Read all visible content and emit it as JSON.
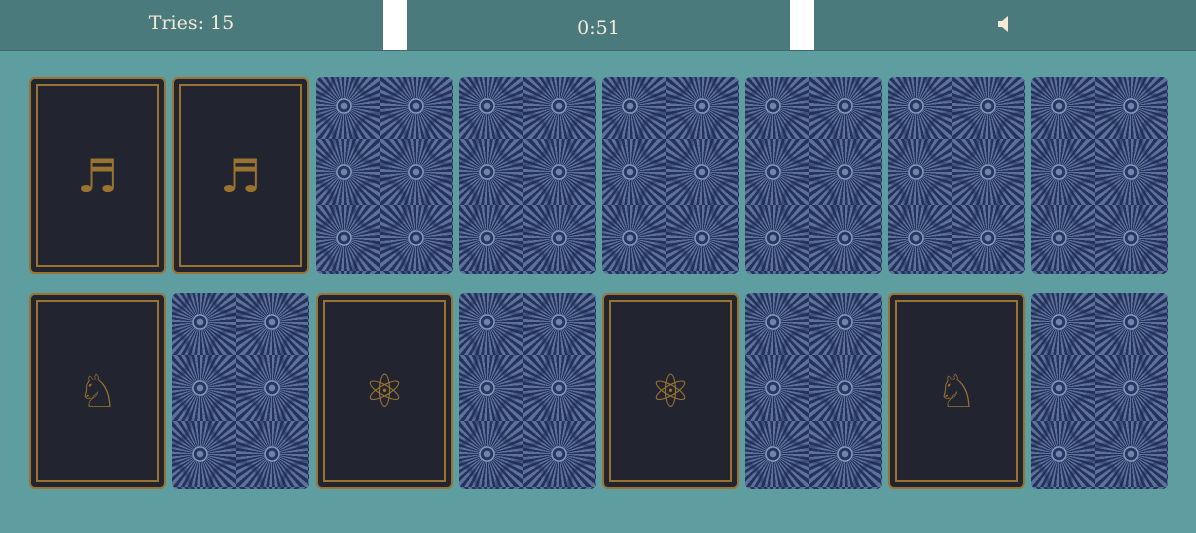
{
  "header": {
    "tries_text": "Tries: 15",
    "timer_text": "0:51",
    "sound_icon": "speaker-icon"
  },
  "colors": {
    "background": "#5e9ea0",
    "topbar": "#4a7a7c",
    "card_face": "#222430",
    "card_gold": "#9a7330",
    "card_back": "#263763",
    "text": "#f3ead8"
  },
  "board": {
    "rows": 2,
    "cols": 8,
    "cards": [
      {
        "state": "face-up",
        "symbol": "♬",
        "icon": "music-notes-icon"
      },
      {
        "state": "face-up",
        "symbol": "♬",
        "icon": "music-notes-icon"
      },
      {
        "state": "face-down"
      },
      {
        "state": "face-down"
      },
      {
        "state": "face-down"
      },
      {
        "state": "face-down"
      },
      {
        "state": "face-down"
      },
      {
        "state": "face-down"
      },
      {
        "state": "face-up",
        "symbol": "♘",
        "icon": "chess-knight-icon"
      },
      {
        "state": "face-down"
      },
      {
        "state": "face-up",
        "symbol": "⚛",
        "icon": "atom-icon"
      },
      {
        "state": "face-down"
      },
      {
        "state": "face-up",
        "symbol": "⚛",
        "icon": "atom-icon"
      },
      {
        "state": "face-down"
      },
      {
        "state": "face-up",
        "symbol": "♘",
        "icon": "chess-knight-icon"
      },
      {
        "state": "face-down"
      }
    ]
  }
}
